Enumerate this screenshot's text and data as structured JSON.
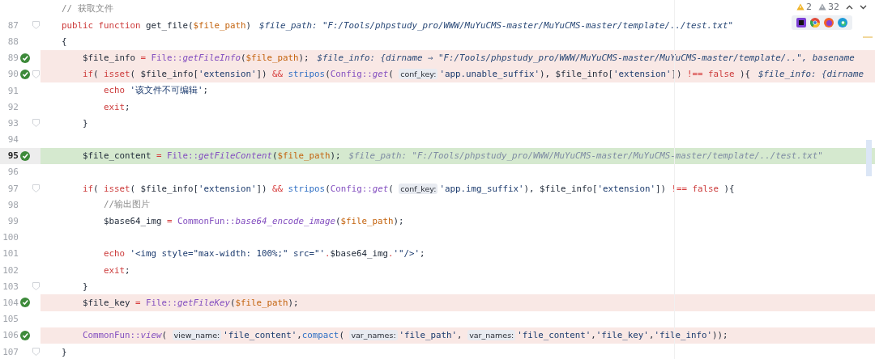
{
  "inspections": [
    {
      "kind": "warning",
      "count": "2"
    },
    {
      "kind": "weak_warning",
      "count": "32"
    }
  ],
  "lines": [
    {
      "breakpoint": false,
      "current": false,
      "fold": false,
      "tokens": [
        {
          "kind": "cmt",
          "text": "    // 获取文件"
        }
      ]
    },
    {
      "number": "87",
      "breakpoint": false,
      "current": false,
      "fold": true,
      "tokens": [
        {
          "kind": "kw",
          "text": "    public"
        },
        {
          "kind": "kw",
          "text": " function"
        },
        {
          "kind": "plain",
          "text": " get_file("
        },
        {
          "kind": "param",
          "text": "$file_path"
        },
        {
          "kind": "plain",
          "text": ")"
        }
      ],
      "hint": {
        "text": "$file_path: \"F:/Tools/phpstudy_pro/WWW/MuYuCMS-master/MuYuCMS-master/template/../test.txt\"",
        "dim": false
      }
    },
    {
      "number": "88",
      "breakpoint": false,
      "current": false,
      "fold": false,
      "tokens": [
        {
          "kind": "plain",
          "text": "    {"
        }
      ]
    },
    {
      "number": "89",
      "breakpoint": true,
      "current": false,
      "fold": false,
      "tokens": [
        {
          "kind": "plain",
          "text": "        $file_info "
        },
        {
          "kind": "op",
          "text": "="
        },
        {
          "kind": "cls",
          "text": " File::"
        },
        {
          "kind": "sfn",
          "text": "getFileInfo"
        },
        {
          "kind": "plain",
          "text": "("
        },
        {
          "kind": "param",
          "text": "$file_path"
        },
        {
          "kind": "plain",
          "text": ");"
        }
      ],
      "hint": {
        "text": "$file_info: {dirname ⇒ \"F:/Tools/phpstudy_pro/WWW/MuYuCMS-master/MuYuCMS-master/template/..\", basename",
        "dim": false
      }
    },
    {
      "number": "90",
      "breakpoint": true,
      "current": false,
      "fold": true,
      "tokens": [
        {
          "kind": "kw",
          "text": "        if"
        },
        {
          "kind": "plain",
          "text": "( "
        },
        {
          "kind": "kw",
          "text": "isset"
        },
        {
          "kind": "plain",
          "text": "( $file_info["
        },
        {
          "kind": "str",
          "text": "'extension'"
        },
        {
          "kind": "plain",
          "text": "]) "
        },
        {
          "kind": "op",
          "text": "&&"
        },
        {
          "kind": "fn",
          "text": " stripos"
        },
        {
          "kind": "plain",
          "text": "("
        },
        {
          "kind": "cls",
          "text": "Config::"
        },
        {
          "kind": "sfn",
          "text": "get"
        },
        {
          "kind": "plain",
          "text": "( "
        },
        {
          "kind": "chip",
          "text": "conf_key:"
        },
        {
          "kind": "str",
          "text": "'app.unable_suffix'"
        },
        {
          "kind": "plain",
          "text": "), $file_info["
        },
        {
          "kind": "str",
          "text": "'extension'"
        },
        {
          "kind": "plain",
          "text": "]) "
        },
        {
          "kind": "op",
          "text": "!=="
        },
        {
          "kind": "kw",
          "text": " false"
        },
        {
          "kind": "plain",
          "text": " ){"
        }
      ],
      "hint": {
        "text": "$file_info: {dirname",
        "dim": false
      }
    },
    {
      "number": "91",
      "breakpoint": false,
      "current": false,
      "fold": false,
      "tokens": [
        {
          "kind": "kw",
          "text": "            echo"
        },
        {
          "kind": "str",
          "text": " '该文件不可编辑'"
        },
        {
          "kind": "plain",
          "text": ";"
        }
      ]
    },
    {
      "number": "92",
      "breakpoint": false,
      "current": false,
      "fold": false,
      "tokens": [
        {
          "kind": "kw",
          "text": "            exit"
        },
        {
          "kind": "plain",
          "text": ";"
        }
      ]
    },
    {
      "number": "93",
      "breakpoint": false,
      "current": false,
      "fold": true,
      "tokens": [
        {
          "kind": "plain",
          "text": "        }"
        }
      ]
    },
    {
      "number": "94",
      "breakpoint": false,
      "current": false,
      "fold": false
    },
    {
      "number": "95",
      "breakpoint": true,
      "current": true,
      "fold": false,
      "tokens": [
        {
          "kind": "plain",
          "text": "        $file_content "
        },
        {
          "kind": "op",
          "text": "="
        },
        {
          "kind": "cls",
          "text": " File::"
        },
        {
          "kind": "sfn",
          "text": "getFileContent"
        },
        {
          "kind": "plain",
          "text": "("
        },
        {
          "kind": "param",
          "text": "$file_path"
        },
        {
          "kind": "plain",
          "text": ");"
        }
      ],
      "hint": {
        "text": "$file_path: \"F:/Tools/phpstudy_pro/WWW/MuYuCMS-master/MuYuCMS-master/template/../test.txt\"",
        "dim": true
      }
    },
    {
      "number": "96",
      "breakpoint": false,
      "current": false,
      "fold": false
    },
    {
      "number": "97",
      "breakpoint": false,
      "current": false,
      "fold": true,
      "tokens": [
        {
          "kind": "kw",
          "text": "        if"
        },
        {
          "kind": "plain",
          "text": "( "
        },
        {
          "kind": "kw",
          "text": "isset"
        },
        {
          "kind": "plain",
          "text": "( $file_info["
        },
        {
          "kind": "str",
          "text": "'extension'"
        },
        {
          "kind": "plain",
          "text": "]) "
        },
        {
          "kind": "op",
          "text": "&&"
        },
        {
          "kind": "fn",
          "text": " stripos"
        },
        {
          "kind": "plain",
          "text": "("
        },
        {
          "kind": "cls",
          "text": "Config::"
        },
        {
          "kind": "sfn",
          "text": "get"
        },
        {
          "kind": "plain",
          "text": "( "
        },
        {
          "kind": "chip",
          "text": "conf_key:"
        },
        {
          "kind": "str",
          "text": "'app.img_suffix'"
        },
        {
          "kind": "plain",
          "text": "), $file_info["
        },
        {
          "kind": "str",
          "text": "'extension'"
        },
        {
          "kind": "plain",
          "text": "]) "
        },
        {
          "kind": "op",
          "text": "!=="
        },
        {
          "kind": "kw",
          "text": " false"
        },
        {
          "kind": "plain",
          "text": " ){"
        }
      ]
    },
    {
      "number": "98",
      "breakpoint": false,
      "current": false,
      "fold": false,
      "tokens": [
        {
          "kind": "cmt",
          "text": "            //输出图片"
        }
      ]
    },
    {
      "number": "99",
      "breakpoint": false,
      "current": false,
      "fold": false,
      "tokens": [
        {
          "kind": "plain",
          "text": "            $base64_img "
        },
        {
          "kind": "op",
          "text": "="
        },
        {
          "kind": "cls",
          "text": " CommonFun::"
        },
        {
          "kind": "sfn",
          "text": "base64_encode_image"
        },
        {
          "kind": "plain",
          "text": "("
        },
        {
          "kind": "param",
          "text": "$file_path"
        },
        {
          "kind": "plain",
          "text": ");"
        }
      ]
    },
    {
      "number": "100",
      "breakpoint": false,
      "current": false,
      "fold": false
    },
    {
      "number": "101",
      "breakpoint": false,
      "current": false,
      "fold": false,
      "tokens": [
        {
          "kind": "kw",
          "text": "            echo"
        },
        {
          "kind": "str",
          "text": " '<img style=\"max-width: 100%;\" src=\"'"
        },
        {
          "kind": "op",
          "text": "."
        },
        {
          "kind": "plain",
          "text": "$base64_img"
        },
        {
          "kind": "op",
          "text": "."
        },
        {
          "kind": "str",
          "text": "'\"/>'"
        },
        {
          "kind": "plain",
          "text": ";"
        }
      ]
    },
    {
      "number": "102",
      "breakpoint": false,
      "current": false,
      "fold": false,
      "tokens": [
        {
          "kind": "kw",
          "text": "            exit"
        },
        {
          "kind": "plain",
          "text": ";"
        }
      ]
    },
    {
      "number": "103",
      "breakpoint": false,
      "current": false,
      "fold": true,
      "tokens": [
        {
          "kind": "plain",
          "text": "        }"
        }
      ]
    },
    {
      "number": "104",
      "breakpoint": true,
      "current": false,
      "fold": false,
      "tokens": [
        {
          "kind": "plain",
          "text": "        $file_key "
        },
        {
          "kind": "op",
          "text": "="
        },
        {
          "kind": "cls",
          "text": " File::"
        },
        {
          "kind": "sfn",
          "text": "getFileKey"
        },
        {
          "kind": "plain",
          "text": "("
        },
        {
          "kind": "param",
          "text": "$file_path"
        },
        {
          "kind": "plain",
          "text": ");"
        }
      ]
    },
    {
      "number": "105",
      "breakpoint": false,
      "current": false,
      "fold": false
    },
    {
      "number": "106",
      "breakpoint": true,
      "current": false,
      "fold": false,
      "tokens": [
        {
          "kind": "cls",
          "text": "        CommonFun::"
        },
        {
          "kind": "sfn",
          "text": "view"
        },
        {
          "kind": "plain",
          "text": "( "
        },
        {
          "kind": "chip",
          "text": "view_name:"
        },
        {
          "kind": "str",
          "text": "'file_content'"
        },
        {
          "kind": "plain",
          "text": ","
        },
        {
          "kind": "fn",
          "text": "compact"
        },
        {
          "kind": "plain",
          "text": "( "
        },
        {
          "kind": "chip",
          "text": "var_names:"
        },
        {
          "kind": "str",
          "text": "'file_path'"
        },
        {
          "kind": "plain",
          "text": ", "
        },
        {
          "kind": "chip",
          "text": "var_names:"
        },
        {
          "kind": "str",
          "text": "'file_content'"
        },
        {
          "kind": "plain",
          "text": ","
        },
        {
          "kind": "str",
          "text": "'file_key'"
        },
        {
          "kind": "plain",
          "text": ","
        },
        {
          "kind": "str",
          "text": "'file_info'"
        },
        {
          "kind": "plain",
          "text": "));"
        }
      ]
    },
    {
      "number": "107",
      "breakpoint": false,
      "current": false,
      "fold": true,
      "tokens": [
        {
          "kind": "plain",
          "text": "    }"
        }
      ]
    }
  ]
}
